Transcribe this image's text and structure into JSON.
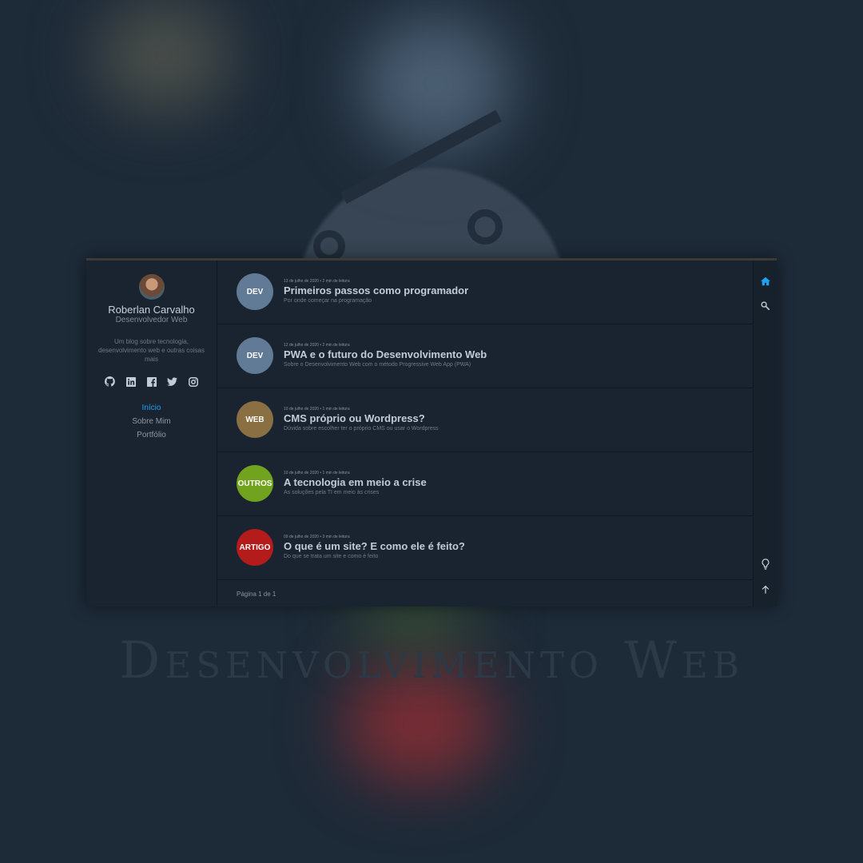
{
  "background": {
    "caption": "Desenvolvimento Web"
  },
  "profile": {
    "name": "Roberlan Carvalho",
    "position": "Desenvolvedor Web",
    "description": "Um blog sobre tecnologia, desenvolvimento web e outras coisas mais"
  },
  "socials": [
    {
      "name": "github-icon"
    },
    {
      "name": "linkedin-icon"
    },
    {
      "name": "facebook-icon"
    },
    {
      "name": "twitter-icon"
    },
    {
      "name": "instagram-icon"
    }
  ],
  "nav": {
    "items": [
      {
        "label": "Início",
        "active": true
      },
      {
        "label": "Sobre Mim",
        "active": false
      },
      {
        "label": "Portfólio",
        "active": false
      }
    ]
  },
  "posts": [
    {
      "tag": "DEV",
      "color": "#617b96",
      "meta": "13 de julho de 2020 • 2 min de leitura",
      "title": "Primeiros passos como programador",
      "description": "Por onde começar na programação"
    },
    {
      "tag": "DEV",
      "color": "#617b96",
      "meta": "12 de julho de 2020 • 2 min de leitura",
      "title": "PWA e o futuro do Desenvolvimento Web",
      "description": "Sobre o Desenvolvimento Web com o método Progressive Web App (PWA)"
    },
    {
      "tag": "WEB",
      "color": "#8a6f43",
      "meta": "10 de julho de 2020 • 1 min de leitura",
      "title": "CMS próprio ou Wordpress?",
      "description": "Dúvida sobre escolher ter o próprio CMS ou usar o Wordpress"
    },
    {
      "tag": "OUTROS",
      "color": "#71a31e",
      "meta": "10 de julho de 2020 • 1 min de leitura",
      "title": "A tecnologia em meio a crise",
      "description": "As soluções pela TI em meio às crises"
    },
    {
      "tag": "ARTIGO",
      "color": "#b41b1b",
      "meta": "09 de julho de 2020 • 3 min de leitura",
      "title": "O que é um site? E como ele é feito?",
      "description": "Do que se trata um site e como é feito"
    }
  ],
  "pagination": {
    "text": "Página 1 de 1"
  },
  "colors": {
    "accent": "#1fa1f2"
  }
}
